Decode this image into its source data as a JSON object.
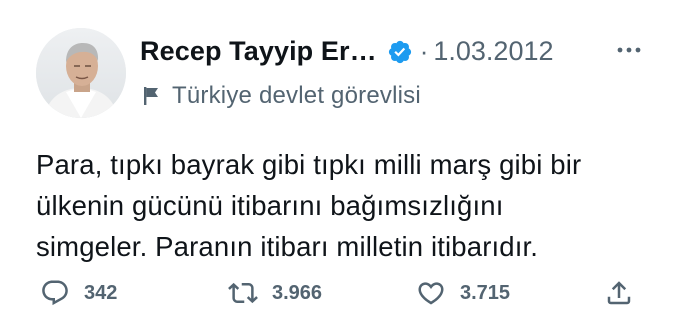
{
  "author": {
    "name": "Recep Tayyip Er…",
    "verified_icon": "verified-badge-icon",
    "date": "1.03.2012",
    "label": "Türkiye devlet görevlisi",
    "label_icon": "flag-icon"
  },
  "tweet": {
    "lines": [
      "Para, tıpkı bayrak gibi tıpkı milli marş gibi bir",
      "ülkenin gücünü itibarını bağımsızlığını",
      "simgeler. Paranın itibarı milletin itibarıdır."
    ]
  },
  "separator": "·",
  "actions": {
    "reply": {
      "icon": "reply-icon",
      "count": "342"
    },
    "retweet": {
      "icon": "retweet-icon",
      "count": "3.966"
    },
    "like": {
      "icon": "heart-icon",
      "count": "3.715"
    },
    "share": {
      "icon": "share-icon"
    }
  },
  "colors": {
    "verified": "#1d9bf0",
    "text": "#0f1419",
    "secondary": "#536471"
  }
}
